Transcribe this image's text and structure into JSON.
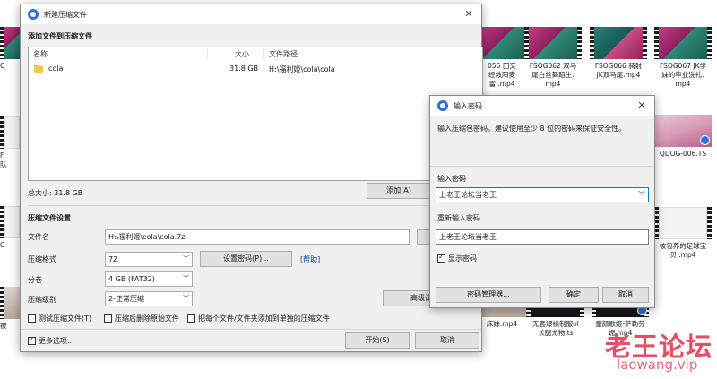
{
  "background_files": {
    "row1": [
      {
        "name": "056 囗交\n经救阳麦\n雷 .mp4",
        "style": "magenta"
      },
      {
        "name": "FSOG062 双马\n尾白丝舞蹈生.\nmp4",
        "style": "magenta"
      },
      {
        "name": "FSOG066 骑射\nJK双马尾.mp4",
        "style": "teal"
      },
      {
        "name": "FSOG067 JK学\n妹的毕业洗礼.\nmp4",
        "style": "magenta"
      }
    ],
    "row2": [
      {
        "name": "QDOG-006.TS",
        "style": "pink"
      }
    ],
    "row3": [
      {
        "name": "被包养的足球宝\n贝 .mp4",
        "style": "white"
      }
    ],
    "row4": [
      {
        "name": "床妹.mp4",
        "style": "dark"
      },
      {
        "name": "无套爆操制服ol\n长腿尤物.ts",
        "style": "dark"
      },
      {
        "name": "童颜歌姬-萨勒芬\n妮.mp4",
        "style": "dark"
      }
    ],
    "left_edge": [
      "C",
      "F",
      "队",
      "C",
      "被"
    ]
  },
  "main_dialog": {
    "title": "新建压缩文件",
    "close_icon": "✕",
    "section_add": "添加文件到压缩文件",
    "columns": {
      "name": "名称",
      "size": "大小",
      "path": "文件路径"
    },
    "files": [
      {
        "name": "cola",
        "size": "31.8 GB",
        "path": "H:\\福利姬\\cola\\cola"
      }
    ],
    "total_size": "总大小: 31.8 GB",
    "add_button": "添加(A)",
    "section_settings": "压缩文件设置",
    "filename_label": "文件名",
    "filename_value": "H:\\福利姬\\cola\\cola.7z",
    "format_label": "压缩格式",
    "format_value": "7Z",
    "set_password_button": "设置密码(P)...",
    "help_link": "[帮助]",
    "split_label": "分卷",
    "split_value": "4 GB (FAT32)",
    "level_label": "压缩级别",
    "level_value": "2-正常压缩",
    "advanced_button": "高级设",
    "test_checkbox": "测试压缩文件(T)",
    "delete_checkbox": "压缩后删除原始文件",
    "separate_checkbox": "把每个文件/文件夹添加到单独的压缩文件",
    "more_options": "更多选项...",
    "start_button": "开始(S)",
    "cancel_button": "取消"
  },
  "password_dialog": {
    "title": "输入密码",
    "close_icon": "✕",
    "hint": "输入压缩包密码。建议使用至少 8 位的密码来保证安全性。",
    "enter_label": "输入密码",
    "enter_value": "上老王论坛当老王",
    "reenter_label": "重新输入密码",
    "reenter_value": "上老王论坛当老王",
    "show_password": "显示密码",
    "manager_button": "密码管理器...",
    "ok_button": "确定",
    "cancel_button": "取消"
  },
  "watermark": {
    "line1": "老王论坛",
    "line2": "laowang.vip"
  }
}
